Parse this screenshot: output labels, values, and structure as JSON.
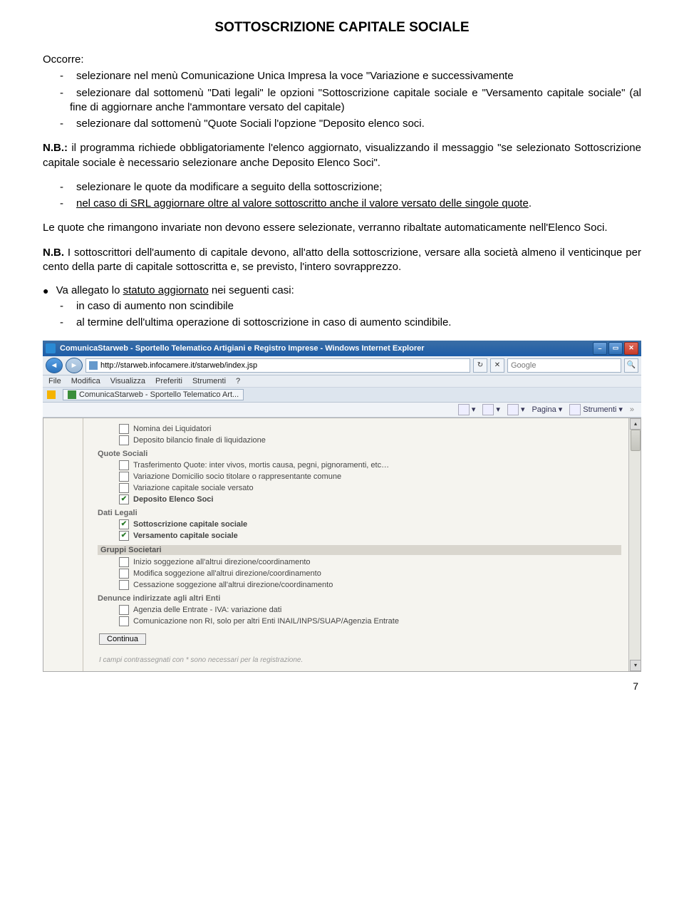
{
  "title": "SOTTOSCRIZIONE CAPITALE SOCIALE",
  "intro": "Occorre:",
  "steps1": [
    "selezionare nel menù Comunicazione  Unica Impresa la voce \"Variazione e successivamente",
    "selezionare dal sottomenù \"Dati legali\" le opzioni \"Sottoscrizione capitale sociale e \"Versamento capitale sociale\" (al fine di aggiornare anche l'ammontare versato del capitale)",
    "selezionare dal sottomenù \"Quote Sociali l'opzione \"Deposito elenco soci."
  ],
  "nb1": {
    "prefix": "N.B.:",
    "text": " il programma richiede obbligatoriamente l'elenco aggiornato, visualizzando il messaggio \"se selezionato Sottoscrizione capitale sociale è necessario selezionare anche Deposito Elenco Soci\"."
  },
  "steps2": [
    {
      "plain": "selezionare le quote da modificare a seguito della sottoscrizione;"
    },
    {
      "under": "nel caso di SRL aggiornare oltre al valore sottoscritto anche il valore versato delle singole quote",
      "tail": "."
    }
  ],
  "para2": "Le quote che rimangono invariate non devono essere selezionate, verranno ribaltate automaticamente nell'Elenco Soci.",
  "nb2": {
    "prefix": "N.B.",
    "text": " I sottoscrittori dell'aumento di capitale devono, all'atto della sottoscrizione, versare alla società almeno il venticinque per cento della parte di capitale sottoscritta e, se previsto, l'intero sovrapprezzo."
  },
  "bullet": {
    "lead": "Va allegato lo ",
    "under": "statuto aggiornato",
    "tail": " nei seguenti casi:"
  },
  "steps3": [
    "in caso di aumento non scindibile",
    "al termine dell'ultima operazione di sottoscrizione in caso di aumento scindibile."
  ],
  "page_number": "7",
  "shot": {
    "window_title": "ComunicaStarweb - Sportello Telematico Artigiani e Registro Imprese - Windows Internet Explorer",
    "url": "http://starweb.infocamere.it/starweb/index.jsp",
    "search_placeholder": "Google",
    "menu": [
      "File",
      "Modifica",
      "Visualizza",
      "Preferiti",
      "Strumenti",
      "?"
    ],
    "tab_label": "ComunicaStarweb - Sportello Telematico Art...",
    "tools": [
      "Pagina",
      "Strumenti"
    ],
    "sections": {
      "top_item": "Nomina dei Liquidatori",
      "top_item2": "Deposito bilancio finale di liquidazione",
      "quote_sociali": {
        "label": "Quote Sociali",
        "items": [
          {
            "label": "Trasferimento Quote: inter vivos, mortis causa, pegni, pignoramenti, etc…",
            "checked": false
          },
          {
            "label": "Variazione Domicilio socio titolare o rappresentante comune",
            "checked": false
          },
          {
            "label": "Variazione capitale sociale versato",
            "checked": false
          },
          {
            "label": "Deposito Elenco Soci",
            "checked": true
          }
        ]
      },
      "dati_legali": {
        "label": "Dati Legali",
        "items": [
          {
            "label": "Sottoscrizione capitale sociale",
            "checked": true
          },
          {
            "label": "Versamento capitale sociale",
            "checked": true
          }
        ]
      },
      "gruppi": {
        "label": "Gruppi Societari",
        "items": [
          {
            "label": "Inizio soggezione all'altrui direzione/coordinamento",
            "checked": false
          },
          {
            "label": "Modifica soggezione all'altrui direzione/coordinamento",
            "checked": false
          },
          {
            "label": "Cessazione soggezione all'altrui direzione/coordinamento",
            "checked": false
          }
        ]
      },
      "denunce": {
        "label": "Denunce indirizzate agli altri Enti",
        "items": [
          {
            "label": "Agenzia delle Entrate - IVA: variazione dati",
            "checked": false
          },
          {
            "label": "Comunicazione non RI, solo per altri Enti INAIL/INPS/SUAP/Agenzia Entrate",
            "checked": false
          }
        ]
      }
    },
    "continua": "Continua",
    "footer": "I campi contrassegnati con * sono necessari per la registrazione."
  }
}
